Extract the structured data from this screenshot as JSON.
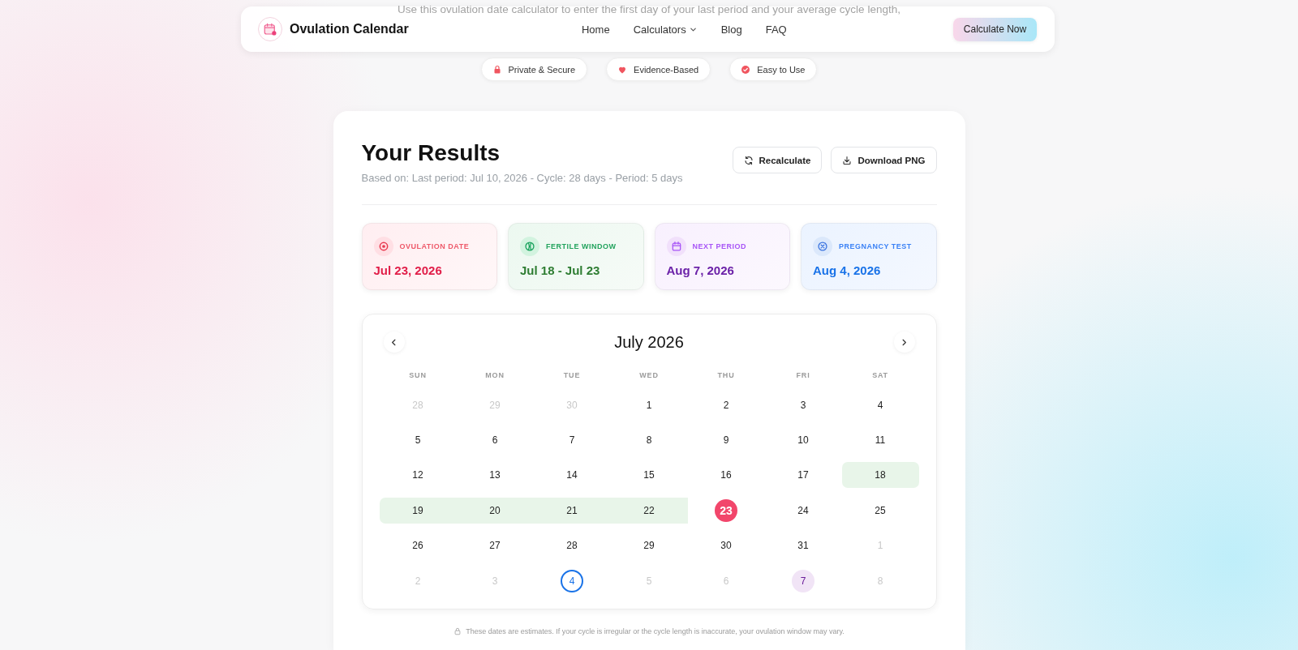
{
  "header": {
    "logo": "Ovulation Calendar",
    "nav": [
      {
        "label": "Home",
        "kind": "link"
      },
      {
        "label": "Calculators",
        "kind": "dropdown"
      },
      {
        "label": "Blog",
        "kind": "link"
      },
      {
        "label": "FAQ",
        "kind": "link"
      }
    ],
    "cta": "Calculate Now"
  },
  "intro": "Use this ovulation date calculator to enter the first day of your last period and your average cycle length,",
  "badges": [
    {
      "label": "Private & Secure",
      "kind": "lock"
    },
    {
      "label": "Evidence-Based",
      "kind": "heart"
    },
    {
      "label": "Easy to Use",
      "kind": "check"
    }
  ],
  "results": {
    "title": "Your Results",
    "summary": "Based on: Last period: Jul 10, 2026 - Cycle: 28 days - Period: 5 days",
    "actions": [
      {
        "label": "Recalculate",
        "kind": "refresh"
      },
      {
        "label": "Download PNG",
        "kind": "download"
      }
    ],
    "stats": [
      {
        "kind": "ovulation",
        "label": "OVULATION DATE",
        "value": "Jul 23, 2026"
      },
      {
        "kind": "fertile",
        "label": "FERTILE WINDOW",
        "value": "Jul 18 - Jul 23"
      },
      {
        "kind": "period",
        "label": "NEXT PERIOD",
        "value": "Aug 7, 2026"
      },
      {
        "kind": "test",
        "label": "PREGNANCY TEST",
        "value": "Aug 4, 2026"
      }
    ]
  },
  "calendar": {
    "month": "July 2026",
    "weekdays": [
      "SUN",
      "MON",
      "TUE",
      "WED",
      "THU",
      "FRI",
      "SAT"
    ],
    "weeks": [
      [
        {
          "day": "28",
          "muted": true,
          "kind": "plain"
        },
        {
          "day": "29",
          "muted": true,
          "kind": "plain"
        },
        {
          "day": "30",
          "muted": true,
          "kind": "plain"
        },
        {
          "day": "1",
          "muted": false,
          "kind": "plain"
        },
        {
          "day": "2",
          "muted": false,
          "kind": "plain"
        },
        {
          "day": "3",
          "muted": false,
          "kind": "plain"
        },
        {
          "day": "4",
          "muted": false,
          "kind": "plain"
        }
      ],
      [
        {
          "day": "5",
          "muted": false,
          "kind": "plain"
        },
        {
          "day": "6",
          "muted": false,
          "kind": "plain"
        },
        {
          "day": "7",
          "muted": false,
          "kind": "plain"
        },
        {
          "day": "8",
          "muted": false,
          "kind": "plain"
        },
        {
          "day": "9",
          "muted": false,
          "kind": "plain"
        },
        {
          "day": "10",
          "muted": false,
          "kind": "plain"
        },
        {
          "day": "11",
          "muted": false,
          "kind": "plain"
        }
      ],
      [
        {
          "day": "12",
          "muted": false,
          "kind": "plain"
        },
        {
          "day": "13",
          "muted": false,
          "kind": "plain"
        },
        {
          "day": "14",
          "muted": false,
          "kind": "plain"
        },
        {
          "day": "15",
          "muted": false,
          "kind": "plain"
        },
        {
          "day": "16",
          "muted": false,
          "kind": "plain"
        },
        {
          "day": "17",
          "muted": false,
          "kind": "plain"
        },
        {
          "day": "18",
          "muted": false,
          "kind": "fertile"
        }
      ],
      [
        {
          "day": "19",
          "muted": false,
          "kind": "fertile"
        },
        {
          "day": "20",
          "muted": false,
          "kind": "fertile"
        },
        {
          "day": "21",
          "muted": false,
          "kind": "fertile"
        },
        {
          "day": "22",
          "muted": false,
          "kind": "fertile"
        },
        {
          "day": "23",
          "muted": false,
          "kind": "ovulation"
        },
        {
          "day": "24",
          "muted": false,
          "kind": "plain"
        },
        {
          "day": "25",
          "muted": false,
          "kind": "plain"
        }
      ],
      [
        {
          "day": "26",
          "muted": false,
          "kind": "plain"
        },
        {
          "day": "27",
          "muted": false,
          "kind": "plain"
        },
        {
          "day": "28",
          "muted": false,
          "kind": "plain"
        },
        {
          "day": "29",
          "muted": false,
          "kind": "plain"
        },
        {
          "day": "30",
          "muted": false,
          "kind": "plain"
        },
        {
          "day": "31",
          "muted": false,
          "kind": "plain"
        },
        {
          "day": "1",
          "muted": true,
          "kind": "plain"
        }
      ],
      [
        {
          "day": "2",
          "muted": true,
          "kind": "plain"
        },
        {
          "day": "3",
          "muted": true,
          "kind": "plain"
        },
        {
          "day": "4",
          "muted": true,
          "kind": "test"
        },
        {
          "day": "5",
          "muted": true,
          "kind": "plain"
        },
        {
          "day": "6",
          "muted": true,
          "kind": "plain"
        },
        {
          "day": "7",
          "muted": true,
          "kind": "period"
        },
        {
          "day": "8",
          "muted": true,
          "kind": "plain"
        }
      ]
    ]
  },
  "note": "These dates are estimates. If your cycle is irregular or the cycle length is inaccurate, your ovulation window may vary."
}
